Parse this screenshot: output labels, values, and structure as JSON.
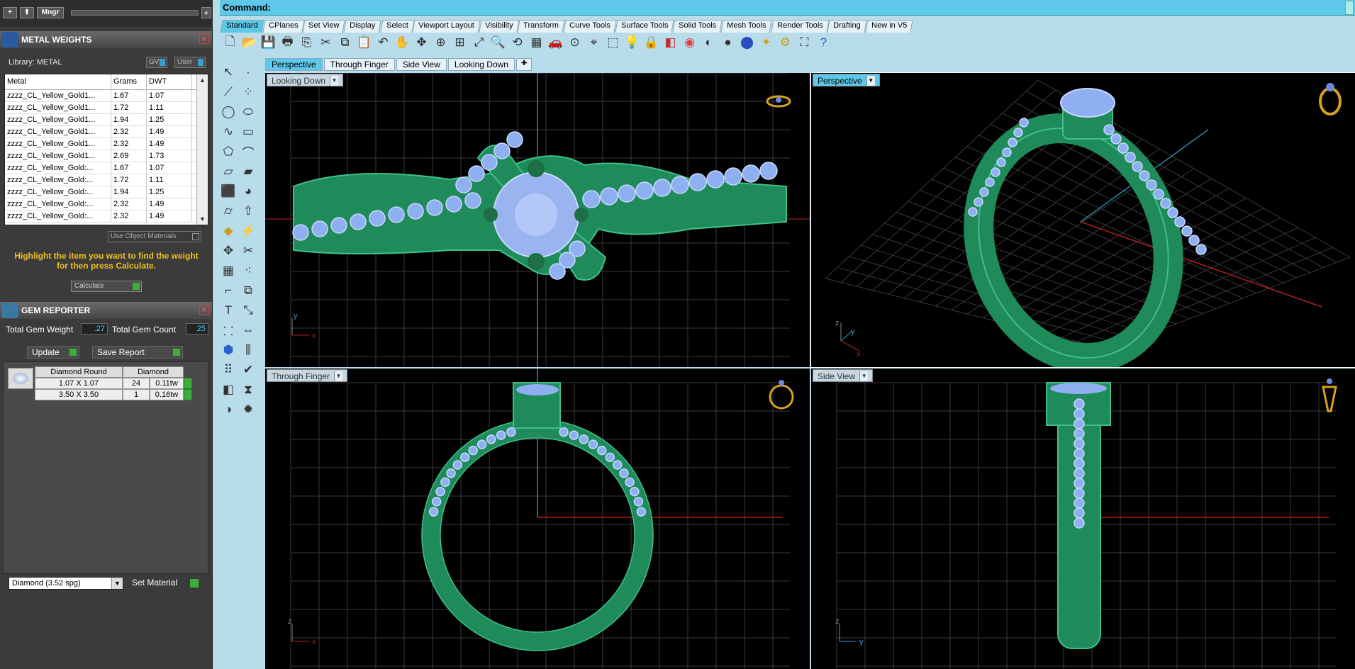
{
  "left_panel": {
    "mini_toolbar": {
      "plus_label": "+",
      "up_label": "⬆",
      "mngr_label": "Mngr",
      "add_label": "+"
    },
    "metal_weights": {
      "title": "METAL WEIGHTS",
      "library_label": "Library: METAL",
      "gv_label": "GV",
      "user_label": "User",
      "columns": [
        "Metal",
        "Grams",
        "DWT"
      ],
      "rows": [
        [
          "zzzz_CL_Yellow_Gold1...",
          "1.67",
          "1.07"
        ],
        [
          "zzzz_CL_Yellow_Gold1...",
          "1.72",
          "1.11"
        ],
        [
          "zzzz_CL_Yellow_Gold1...",
          "1.94",
          "1.25"
        ],
        [
          "zzzz_CL_Yellow_Gold1...",
          "2.32",
          "1.49"
        ],
        [
          "zzzz_CL_Yellow_Gold1...",
          "2.32",
          "1.49"
        ],
        [
          "zzzz_CL_Yellow_Gold1...",
          "2.69",
          "1.73"
        ],
        [
          "zzzz_CL_Yellow_Gold:...",
          "1.67",
          "1.07"
        ],
        [
          "zzzz_CL_Yellow_Gold:...",
          "1.72",
          "1.11"
        ],
        [
          "zzzz_CL_Yellow_Gold:...",
          "1.94",
          "1.25"
        ],
        [
          "zzzz_CL_Yellow_Gold:...",
          "2.32",
          "1.49"
        ],
        [
          "zzzz_CL_Yellow_Gold:...",
          "2.32",
          "1.49"
        ]
      ],
      "use_object_materials": "Use Object Materials",
      "help_text": "Highlight the item you want to find the weight for then press Calculate.",
      "calculate_label": "Calculate"
    },
    "gem_reporter": {
      "title": "GEM REPORTER",
      "total_weight_label": "Total Gem Weight",
      "total_weight_value": ".27",
      "total_count_label": "Total Gem Count",
      "total_count_value": "25",
      "update_label": "Update",
      "save_report_label": "Save Report",
      "columns": [
        "Diamond Round",
        "Diamond"
      ],
      "rows": [
        [
          "1.07 X 1.07",
          "24",
          "0.11tw"
        ],
        [
          "3.50 X 3.50",
          "1",
          "0.16tw"
        ]
      ],
      "material_select": "Diamond    (3.52 spg)",
      "set_material_label": "Set Material"
    }
  },
  "command": {
    "label": "Command:"
  },
  "toolbar_tabs": [
    "Standard",
    "CPlanes",
    "Set View",
    "Display",
    "Select",
    "Viewport Layout",
    "Visibility",
    "Transform",
    "Curve Tools",
    "Surface Tools",
    "Solid Tools",
    "Mesh Tools",
    "Render Tools",
    "Drafting",
    "New in V5"
  ],
  "toolbar_icons": [
    "new-file-icon",
    "open-file-icon",
    "save-icon",
    "print-icon",
    "import-icon",
    "cut-icon",
    "copy-icon",
    "paste-icon",
    "undo-icon",
    "pan-icon",
    "rotate-view-icon",
    "zoom-in-icon",
    "zoom-window-icon",
    "zoom-extents-icon",
    "zoom-selected-icon",
    "undo-view-icon",
    "four-viewports-icon",
    "car-icon",
    "cplane-icon",
    "osnap-icon",
    "select-filter-icon",
    "lightbulb-icon",
    "lock-icon",
    "layer-icon",
    "color-wheel-icon",
    "shaded-sphere-icon",
    "rendered-sphere-icon",
    "blue-sphere-icon",
    "render-icon",
    "gear-icon",
    "group-icon",
    "help-icon"
  ],
  "view_tabs": [
    "Perspective",
    "Through Finger",
    "Side View",
    "Looking Down"
  ],
  "viewports": {
    "looking_down": {
      "label": "Looking Down",
      "axis1": "y",
      "axis2": "x"
    },
    "perspective": {
      "label": "Perspective",
      "axis1": "y",
      "axis2": "x",
      "axis3": "z"
    },
    "through_finger": {
      "label": "Through Finger",
      "axis1": "z",
      "axis2": "x"
    },
    "side_view": {
      "label": "Side View",
      "axis1": "z",
      "axis2": "y"
    }
  },
  "colors": {
    "accent": "#5ec8e8",
    "ring_green": "#1f8a5a",
    "gem_blue": "#8fb0f0",
    "help_yellow": "#f0c020",
    "grid": "#3a3a3a",
    "axis_red": "#b02020",
    "axis_blue": "#2a8aa8"
  }
}
